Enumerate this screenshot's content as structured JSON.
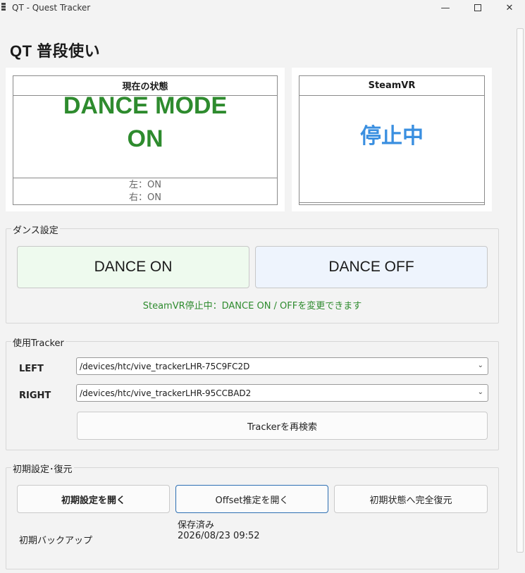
{
  "window": {
    "title": "QT - Quest Tracker",
    "minimize": "—",
    "close": "✕"
  },
  "page": {
    "title": "QT  普段使い"
  },
  "status": {
    "current_header": "現在の状態",
    "dance_line1": "DANCE MODE",
    "dance_line2": "ON",
    "left_status": "左：ON",
    "right_status": "右：ON",
    "steamvr_header": "SteamVR",
    "steamvr_state": "停止中",
    "colors": {
      "on": "#2e8b2e",
      "steam": "#3a8fe0"
    }
  },
  "dance": {
    "group_label": "ダンス設定",
    "on_label": "DANCE ON",
    "off_label": "DANCE OFF",
    "hint": "SteamVR停止中：DANCE ON / OFFを変更できます"
  },
  "tracker": {
    "group_label": "使用Tracker",
    "left_label": "LEFT",
    "left_value": "/devices/htc/vive_trackerLHR-75C9FC2D",
    "right_label": "RIGHT",
    "right_value": "/devices/htc/vive_trackerLHR-95CCBAD2",
    "rescan_label": "Trackerを再検索"
  },
  "initial": {
    "group_label": "初期設定･復元",
    "open_settings": "初期設定を開く",
    "open_offset": "Offset推定を開く",
    "restore": "初期状態へ完全復元",
    "backup_label": "初期バックアップ",
    "backup_status": "保存済み",
    "backup_time": "2026/08/23 09:52"
  }
}
